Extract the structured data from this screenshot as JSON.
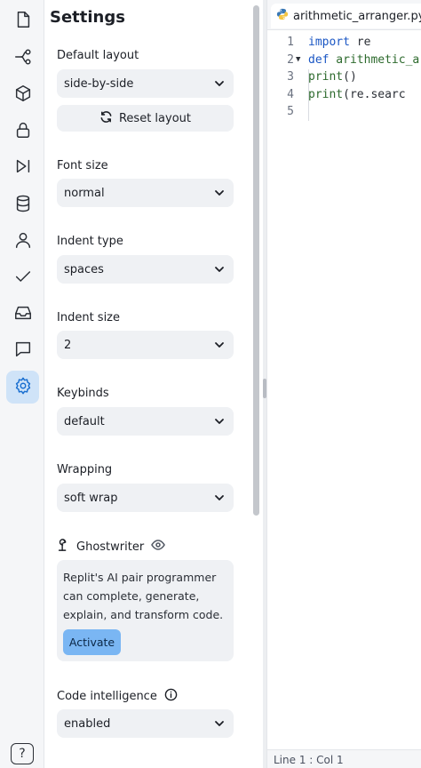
{
  "sidebar": {
    "items": [
      {
        "icon": "file-icon",
        "name": "files"
      },
      {
        "icon": "git-branch-icon",
        "name": "version-control"
      },
      {
        "icon": "package-icon",
        "name": "packages"
      },
      {
        "icon": "lock-icon",
        "name": "secrets"
      },
      {
        "icon": "play-debug-icon",
        "name": "debugger"
      },
      {
        "icon": "database-icon",
        "name": "database"
      },
      {
        "icon": "user-icon",
        "name": "auth"
      },
      {
        "icon": "check-icon",
        "name": "tests"
      },
      {
        "icon": "inbox-icon",
        "name": "threads"
      },
      {
        "icon": "chat-icon",
        "name": "chat"
      },
      {
        "icon": "gear-icon",
        "name": "settings",
        "active": true
      }
    ],
    "help_label": "?"
  },
  "settings": {
    "title": "Settings",
    "default_layout": {
      "label": "Default layout",
      "value": "side-by-side"
    },
    "reset_layout_label": "Reset layout",
    "font_size": {
      "label": "Font size",
      "value": "normal"
    },
    "indent_type": {
      "label": "Indent type",
      "value": "spaces"
    },
    "indent_size": {
      "label": "Indent size",
      "value": "2"
    },
    "keybinds": {
      "label": "Keybinds",
      "value": "default"
    },
    "wrapping": {
      "label": "Wrapping",
      "value": "soft wrap"
    },
    "ghostwriter": {
      "label": "Ghostwriter",
      "description": "Replit's AI pair programmer can complete, generate, explain, and transform code.",
      "activate_label": "Activate"
    },
    "code_intelligence": {
      "label": "Code intelligence",
      "value": "enabled"
    }
  },
  "editor": {
    "tab_name": "arithmetic_arranger.py",
    "lines": [
      {
        "num": "1",
        "parts": [
          {
            "t": "import",
            "c": "kw"
          },
          {
            "t": " re",
            "c": ""
          }
        ]
      },
      {
        "num": "2",
        "fold": true,
        "parts": [
          {
            "t": "def",
            "c": "kw"
          },
          {
            "t": " arithmetic_a",
            "c": "fn"
          }
        ]
      },
      {
        "num": "3",
        "parts": [
          {
            "t": "  print",
            "c": "fn"
          },
          {
            "t": "()",
            "c": ""
          }
        ]
      },
      {
        "num": "4",
        "parts": [
          {
            "t": "  print",
            "c": "fn"
          },
          {
            "t": "(re.searc",
            "c": ""
          }
        ]
      },
      {
        "num": "5",
        "parts": []
      }
    ],
    "status": "Line 1 : Col 1"
  },
  "colors": {
    "accent": "#1a6fd0",
    "active_bg": "#cfe3f8",
    "activate_button": "#7ab6f3"
  }
}
